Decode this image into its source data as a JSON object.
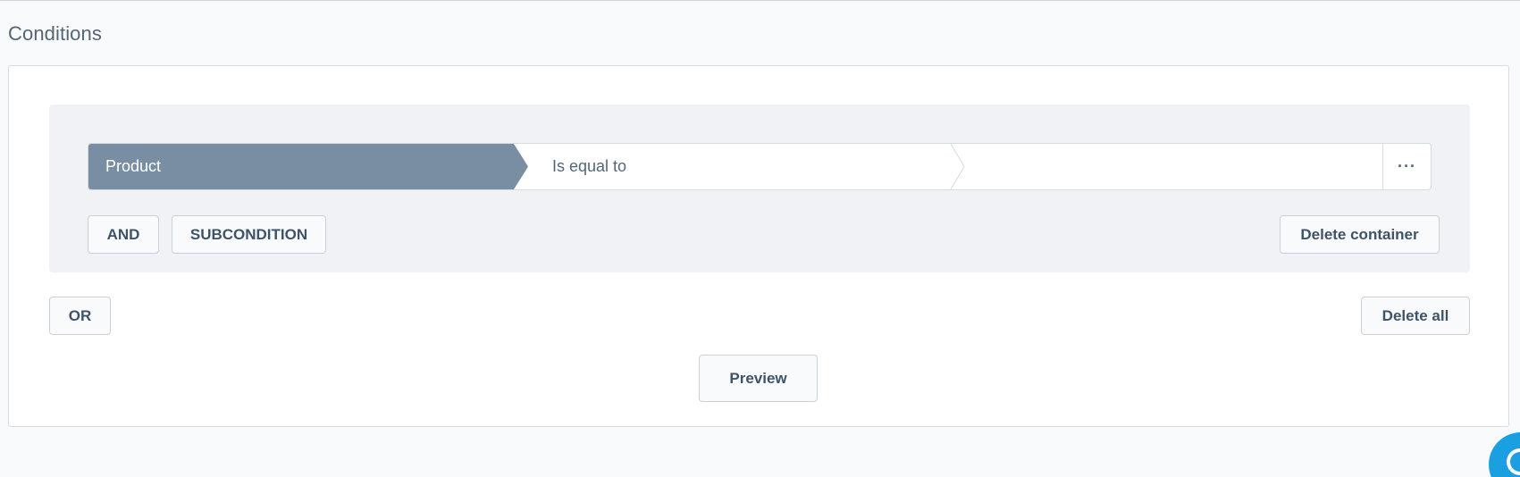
{
  "section": {
    "title": "Conditions"
  },
  "condition": {
    "field": "Product",
    "operator": "Is equal to",
    "value": "",
    "more_label": "···"
  },
  "buttons": {
    "and": "AND",
    "subcondition": "SUBCONDITION",
    "delete_container": "Delete container",
    "or": "OR",
    "delete_all": "Delete all",
    "preview": "Preview"
  },
  "colors": {
    "field_bg": "#798ea2",
    "container_bg": "#f0f2f5",
    "help_bubble": "#1a9fe0"
  },
  "icons": {
    "more": "ellipsis-icon",
    "separator": "chevron-right-icon",
    "help": "chat-help-icon"
  }
}
